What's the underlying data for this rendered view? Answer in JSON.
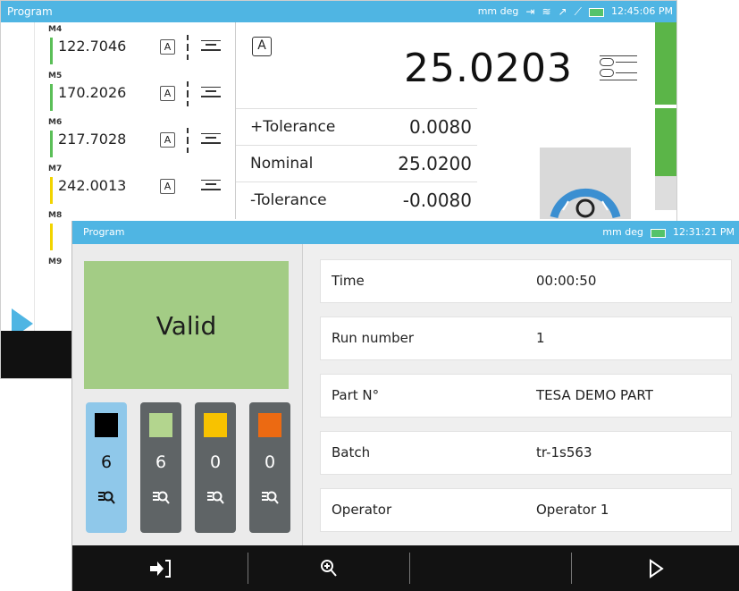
{
  "back_window": {
    "title": "Program",
    "status": {
      "units": "mm deg",
      "time": "12:45:06 PM"
    },
    "measurements": [
      {
        "label": "M4",
        "value": "122.7046",
        "box": "A",
        "bar_color": "#5bbf58"
      },
      {
        "label": "M5",
        "value": "170.2026",
        "box": "A",
        "bar_color": "#5bbf58"
      },
      {
        "label": "M6",
        "value": "217.7028",
        "box": "A",
        "bar_color": "#5bbf58"
      },
      {
        "label": "M7",
        "value": "242.0013",
        "box": "A",
        "bar_color": "#f2d400"
      },
      {
        "label": "M8",
        "value": "",
        "box": "",
        "bar_color": "#f2d400"
      },
      {
        "label": "M9",
        "value": "",
        "box": "",
        "bar_color": ""
      }
    ],
    "main": {
      "box": "A",
      "value": "25.0203",
      "plus_tolerance_label": "+Tolerance",
      "plus_tolerance_value": "0.0080",
      "nominal_label": "Nominal",
      "nominal_value": "25.0200",
      "minus_tolerance_label": "-Tolerance",
      "minus_tolerance_value": "-0.0080"
    }
  },
  "front_window": {
    "title": "Program",
    "status": {
      "units": "mm deg",
      "time": "12:31:21 PM"
    },
    "result": "Valid",
    "counters": [
      {
        "color": "#000000",
        "count": "6",
        "active": true
      },
      {
        "color": "#b3d58e",
        "count": "6",
        "active": false
      },
      {
        "color": "#f8c200",
        "count": "0",
        "active": false
      },
      {
        "color": "#ec6a12",
        "count": "0",
        "active": false
      }
    ],
    "info": [
      {
        "label": "Time",
        "value": "00:00:50"
      },
      {
        "label": "Run number",
        "value": "1"
      },
      {
        "label": "Part N°",
        "value": "TESA DEMO PART"
      },
      {
        "label": "Batch",
        "value": "tr-1s563"
      },
      {
        "label": "Operator",
        "value": "Operator 1"
      }
    ],
    "toolbar": {
      "exit_icon": "enter-icon",
      "zoom_icon": "zoom-in-icon",
      "play_icon": "play-icon"
    }
  },
  "colors": {
    "title_bar": "#4fb5e3",
    "valid": "#a3cc85",
    "counter_bg": "#5f6466",
    "counter_active": "#8fc8ea"
  }
}
